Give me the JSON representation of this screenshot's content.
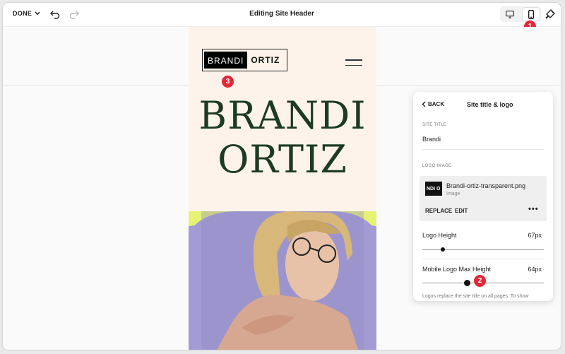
{
  "toolbar": {
    "done_label": "DONE",
    "title": "Editing Site Header",
    "view_desktop_icon": "desktop-icon",
    "view_mobile_icon": "mobile-icon",
    "style_icon": "paintbrush-icon"
  },
  "badges": {
    "b1": "1",
    "b2": "2",
    "b3": "3"
  },
  "preview": {
    "logo_left": "BRANDI",
    "logo_right": "ORTIZ",
    "title_line1": "BRANDI",
    "title_line2": "ORTIZ"
  },
  "panel": {
    "back_label": "BACK",
    "title": "Site title & logo",
    "site_title_label": "SITE TITLE",
    "site_title_value": "Brandi",
    "logo_image_label": "LOGO IMAGE",
    "logo_thumb_text": "NDI O",
    "file_name": "Brandi-ortiz-transparent.png",
    "file_type": "Image",
    "replace_label": "REPLACE",
    "edit_label": "EDIT",
    "more_label": "•••",
    "logo_height_label": "Logo Height",
    "logo_height_value": "67px",
    "mobile_logo_label": "Mobile Logo Max Height",
    "mobile_logo_value": "64px",
    "footnote": "Logos replace the site title on all pages. To show"
  },
  "colors": {
    "accent": "#e3283a",
    "title_green": "#1c3b22",
    "preview_bg": "#fdf3ea",
    "photo_bg": "#e7f274",
    "blob": "#a39bd3"
  }
}
